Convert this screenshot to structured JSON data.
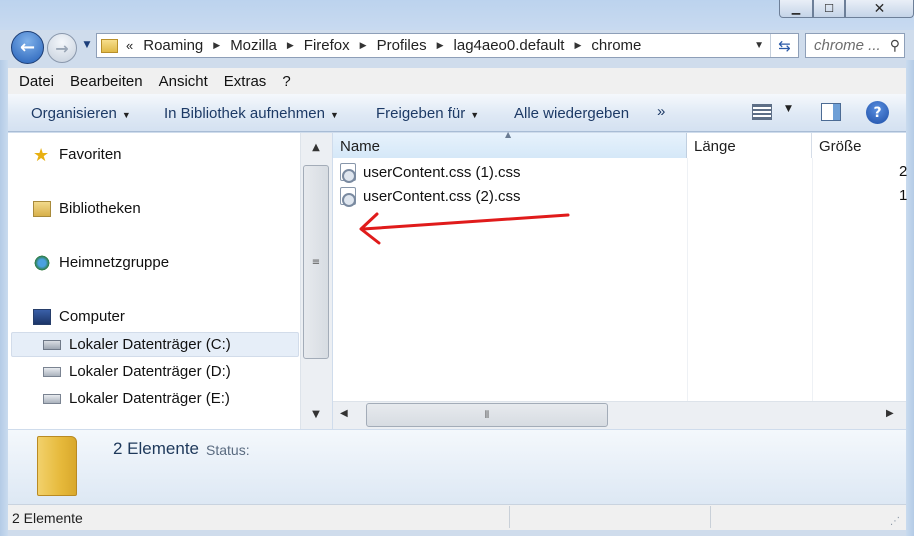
{
  "window": {
    "min_icon": "minimize-icon",
    "max_icon": "maximize-icon",
    "close_icon": "close-icon"
  },
  "nav": {
    "back_icon": "back-arrow-icon",
    "forward_icon": "forward-arrow-icon",
    "overflow": "«"
  },
  "address": {
    "crumbs": [
      "Roaming",
      "Mozilla",
      "Firefox",
      "Profiles",
      "lag4aeo0.default",
      "chrome"
    ]
  },
  "search": {
    "placeholder": "chrome ..."
  },
  "menu": [
    "Datei",
    "Bearbeiten",
    "Ansicht",
    "Extras",
    "?"
  ],
  "toolbar": {
    "organize": "Organisieren",
    "library": "In Bibliothek aufnehmen",
    "share": "Freigeben für",
    "play": "Alle wiedergeben",
    "more": "»",
    "help": "?"
  },
  "navpane": {
    "favorites": "Favoriten",
    "libraries": "Bibliotheken",
    "homegroup": "Heimnetzgruppe",
    "computer": "Computer",
    "drive_c": "Lokaler Datenträger (C:)",
    "drive_d": "Lokaler Datenträger (D:)",
    "drive_e": "Lokaler Datenträger (E:)"
  },
  "columns": {
    "name": "Name",
    "length": "Länge",
    "size": "Größe"
  },
  "files": [
    {
      "name": "userContent.css (1).css",
      "size_partial": "2"
    },
    {
      "name": "userContent.css (2).css",
      "size_partial": "1"
    }
  ],
  "details": {
    "count": "2 Elemente",
    "status": "Status:"
  },
  "statusbar": {
    "count": "2 Elemente"
  },
  "colors": {
    "annotation_arrow": "#e01b1b",
    "accent": "#2560b8"
  }
}
